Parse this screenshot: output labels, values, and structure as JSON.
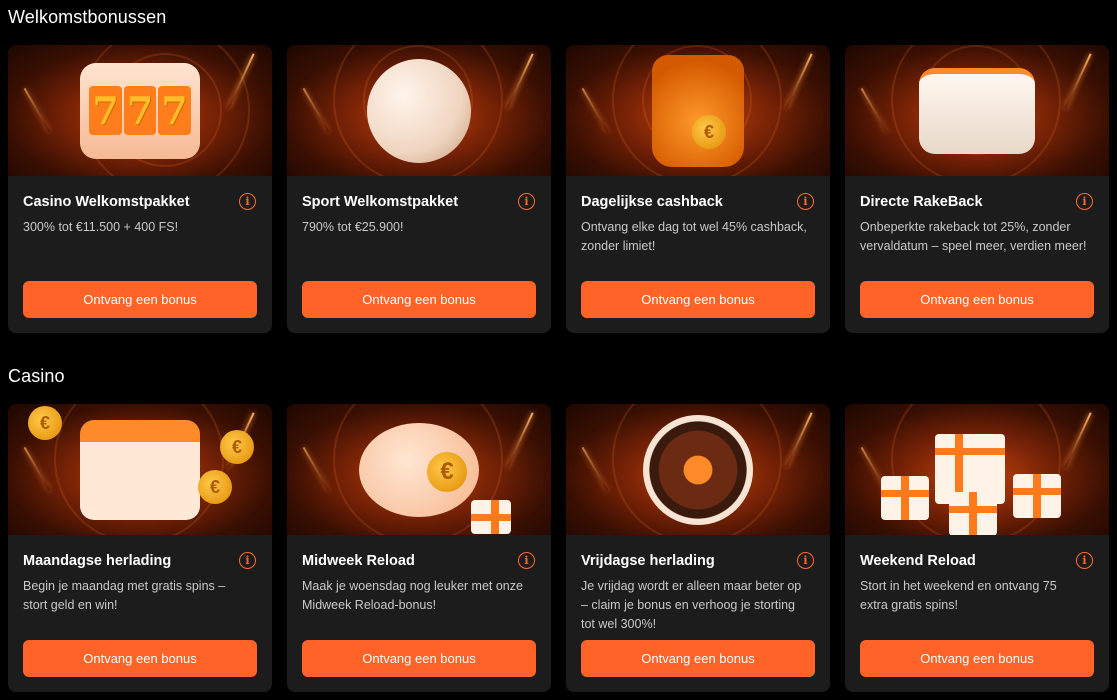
{
  "sections": [
    {
      "title": "Welkomstbonussen",
      "cards": [
        {
          "title": "Casino Welkomstpakket",
          "desc": "300% tot €11.500 + 400 FS!",
          "cta": "Ontvang een bonus",
          "art": "slot-machine"
        },
        {
          "title": "Sport Welkomstpakket",
          "desc": "790% tot €25.900!",
          "cta": "Ontvang een bonus",
          "art": "soccer-ball"
        },
        {
          "title": "Dagelijkse cashback",
          "desc": "Ontvang elke dag tot wel 45% cashback, zonder limiet!",
          "cta": "Ontvang een bonus",
          "art": "coin-jar"
        },
        {
          "title": "Directe RakeBack",
          "desc": "Onbeperkte rakeback tot 25%, zonder vervaldatum – speel meer, verdien meer!",
          "cta": "Ontvang een bonus",
          "art": "wallet"
        }
      ]
    },
    {
      "title": "Casino",
      "cards": [
        {
          "title": "Maandagse herlading",
          "desc": "Begin je maandag met gratis spins – stort geld en win!",
          "cta": "Ontvang een bonus",
          "art": "calendar"
        },
        {
          "title": "Midweek Reload",
          "desc": "Maak je woensdag nog leuker met onze Midweek Reload-bonus!",
          "cta": "Ontvang een bonus",
          "art": "piggy-bank"
        },
        {
          "title": "Vrijdagse herlading",
          "desc": "Je vrijdag wordt er alleen maar beter op – claim je bonus en verhoog je storting tot wel 300%!",
          "cta": "Ontvang een bonus",
          "art": "roulette-wheel"
        },
        {
          "title": "Weekend Reload",
          "desc": "Stort in het weekend en ontvang 75 extra gratis spins!",
          "cta": "Ontvang een bonus",
          "art": "gift-boxes"
        }
      ]
    }
  ],
  "art_text": {
    "slot_digit": "7",
    "euro": "€",
    "info": "i"
  },
  "colors": {
    "background": "#000000",
    "card": "#1c1c1c",
    "accent": "#ff6327",
    "info": "#ff6a2c",
    "desc": "#c9c9c9"
  }
}
